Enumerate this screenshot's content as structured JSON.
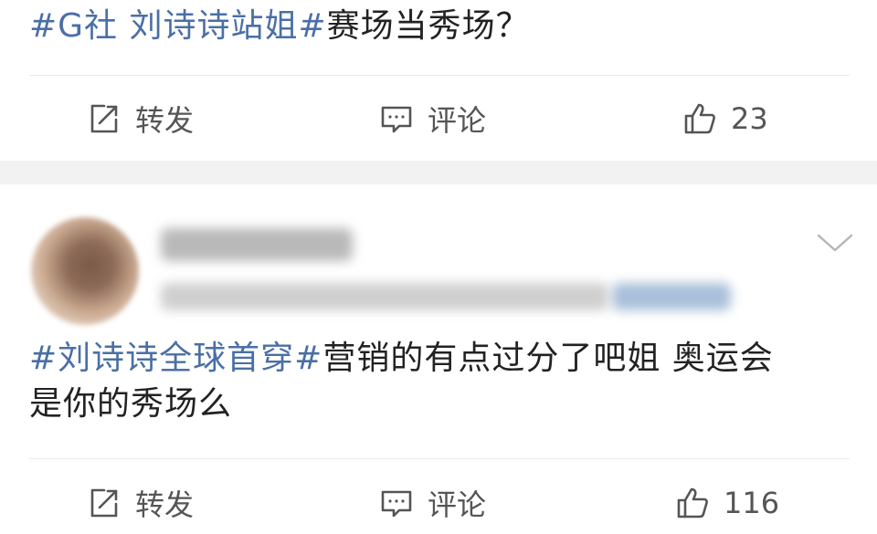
{
  "post1": {
    "hashtag": "#G社 刘诗诗站姐#",
    "text": "赛场当秀场？",
    "actions": {
      "repost_label": "转发",
      "comment_label": "评论",
      "like_count": "23"
    }
  },
  "post2": {
    "hashtag": "#刘诗诗全球首穿#",
    "text_line1": "营销的有点过分了吧姐 奥运会",
    "text_line2": "是你的秀场么",
    "actions": {
      "repost_label": "转发",
      "comment_label": "评论",
      "like_count": "116"
    }
  },
  "icons": {
    "repost": "edit-share-icon",
    "comment": "comment-bubble-icon",
    "like": "thumbs-up-icon",
    "more": "chevron-down-icon"
  },
  "colors": {
    "hashtag": "#4a6fa5",
    "text": "#222222",
    "action": "#555555",
    "separator": "#f2f2f2"
  }
}
